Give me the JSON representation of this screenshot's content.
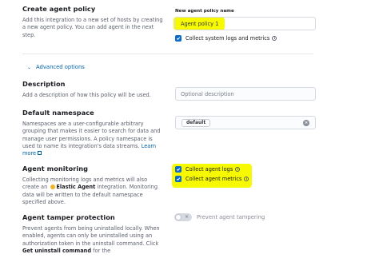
{
  "create_policy": {
    "heading": "Create agent policy",
    "description": "Add this integration to a new set of hosts by creating a new agent policy. You can add agent in the next step.",
    "name_label": "New agent policy name",
    "name_value": "Agent policy 1",
    "collect_system_label": "Collect system logs and metrics",
    "collect_system_checked": true
  },
  "advanced_options": {
    "label": "Advanced options"
  },
  "description_section": {
    "heading": "Description",
    "text": "Add a description of how this policy will be used.",
    "placeholder": "Optional description"
  },
  "namespace": {
    "heading": "Default namespace",
    "text": "Namespaces are a user-configurable arbitrary grouping that makes it easier to search for data and manage user permissions. A policy namespace is used to name its integration's data streams.",
    "learn_more": "Learn more",
    "value": "default"
  },
  "monitoring": {
    "heading": "Agent monitoring",
    "text_before": "Collecting monitoring logs and metrics will also create an",
    "agent_name": "Elastic Agent",
    "text_after": "integration. Monitoring data will be written to the default namespace specified above.",
    "collect_logs_label": "Collect agent logs",
    "collect_metrics_label": "Collect agent metrics"
  },
  "tamper": {
    "heading": "Agent tamper protection",
    "text": "Prevent agents from being uninstalled locally. When enabled, agents can only be uninstalled using an authorization token in the uninstall command. Click",
    "bold_text": "Get uninstall command",
    "text_end": "for the",
    "toggle_label": "Prevent agent tampering"
  },
  "colors": {
    "highlight": "#f6f900",
    "checkbox": "#0a6bcb",
    "link": "#0061a6"
  }
}
